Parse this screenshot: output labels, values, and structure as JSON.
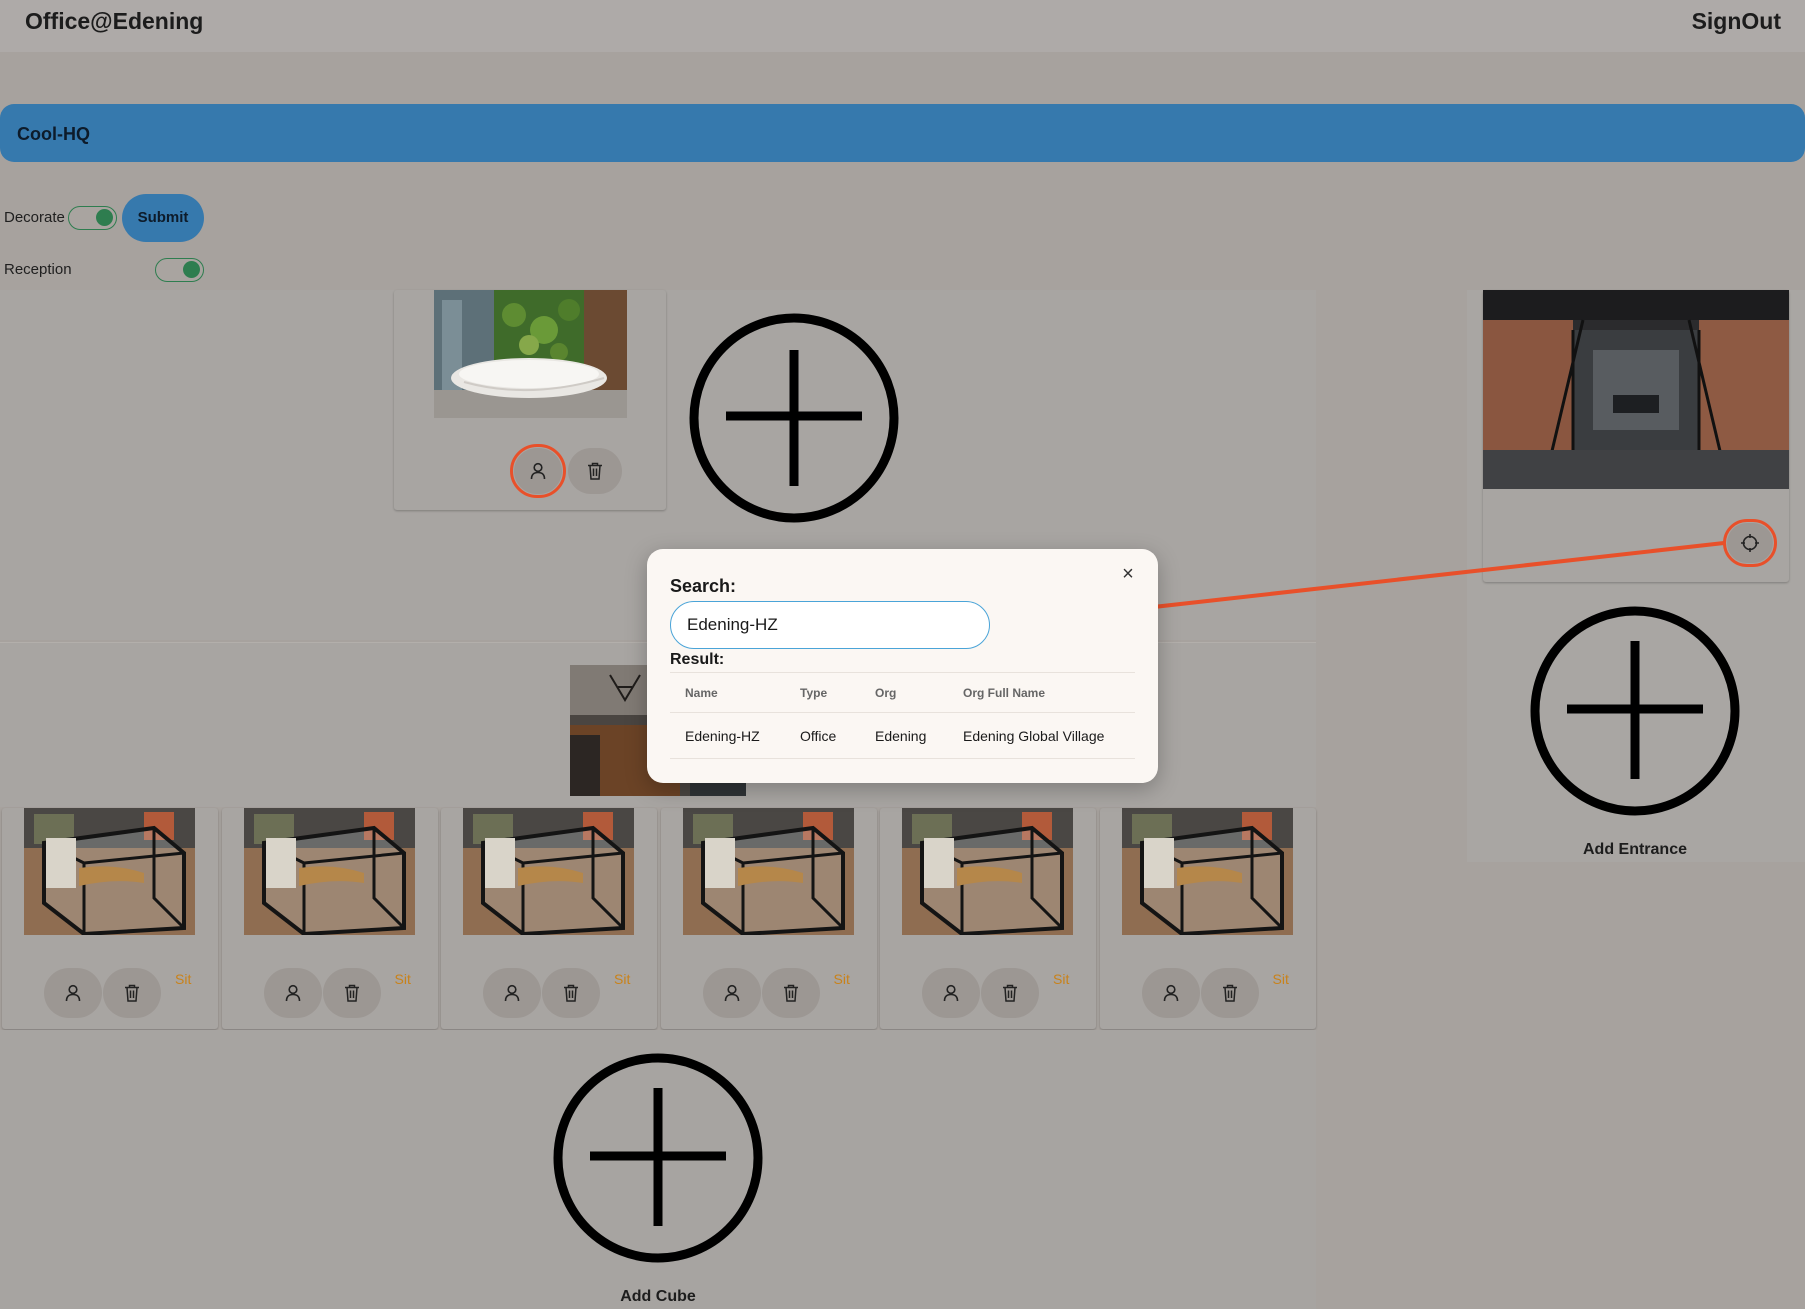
{
  "header": {
    "app_title": "Office@Edening",
    "signout_label": "SignOut"
  },
  "office": {
    "name": "Cool-HQ"
  },
  "controls": {
    "decorate_label": "Decorate",
    "decorate_on": true,
    "submit_label": "Submit",
    "reception_label": "Reception",
    "reception_on": true
  },
  "cubes": {
    "sit_label": "Sit",
    "count": 6,
    "add_label": "Add Cube"
  },
  "entrance": {
    "add_label": "Add Entrance"
  },
  "modal": {
    "search_label": "Search:",
    "search_value": "Edening-HZ",
    "result_label": "Result:",
    "columns": [
      "Name",
      "Type",
      "Org",
      "Org Full Name"
    ],
    "rows": [
      [
        "Edening-HZ",
        "Office",
        "Edening",
        "Edening Global Village"
      ]
    ],
    "close_glyph": "×"
  },
  "colors": {
    "accent_blue": "#3679ad",
    "toggle_green": "#2e7d4f",
    "highlight_orange": "#e8502a",
    "sit_orange": "#c9821a"
  },
  "icons": [
    "user-icon",
    "trash-icon",
    "plus-circle-icon",
    "target-icon",
    "close-icon"
  ]
}
